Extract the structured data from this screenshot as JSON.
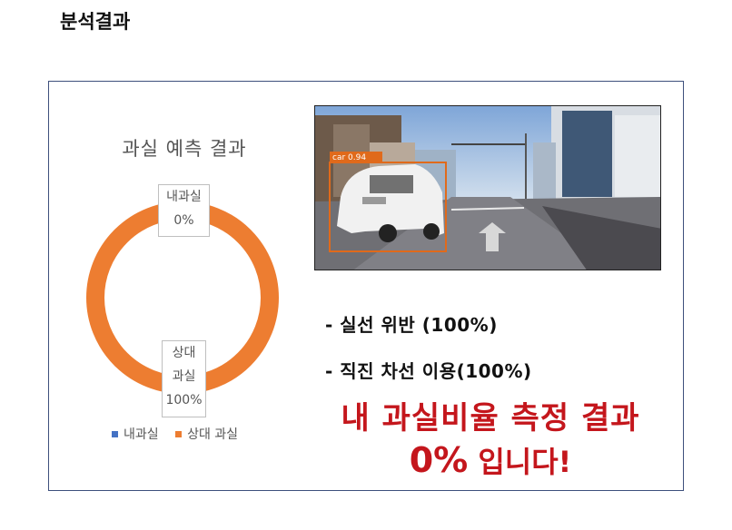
{
  "page": {
    "title": "분석결과"
  },
  "chart_data": {
    "type": "pie",
    "donut": true,
    "title": "과실 예측 결과",
    "categories": [
      "내과실",
      "상대 과실"
    ],
    "values": [
      0,
      100
    ],
    "data_labels": [
      {
        "name": "내과실",
        "value": "0%"
      },
      {
        "name": "상대\n과실",
        "value": "100%"
      }
    ],
    "label_lines": {
      "mine": [
        "내과실",
        "0%"
      ],
      "other": [
        "상대",
        "과실",
        "100%"
      ]
    },
    "legend": {
      "placement": "bottom",
      "entries": [
        "내과실",
        "상대 과실"
      ]
    },
    "colors": [
      "#4472c4",
      "#ed7d31"
    ]
  },
  "image": {
    "description_label": "car 0.94",
    "box_color": "#e06a1b"
  },
  "results": {
    "bullet1": "- 실선 위반 (100%)",
    "bullet2": "- 직진 차선 이용(100%)",
    "line1": "내 과실비율 측정 결과",
    "percent": "0%",
    "line2_rest": " 입니다!",
    "color": "#c4161c"
  }
}
